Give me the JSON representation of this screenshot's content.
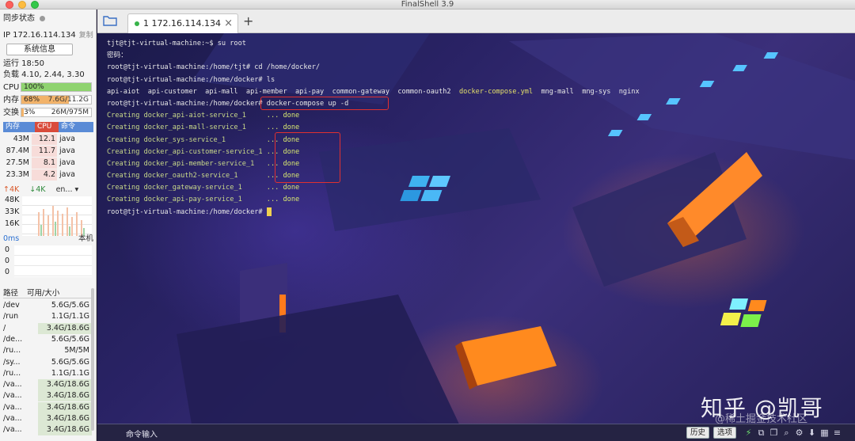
{
  "window": {
    "title": "FinalShell 3.9"
  },
  "sidebar": {
    "sync_status": "同步状态",
    "ip_label": "IP 172.16.114.134",
    "copy_label": "复制",
    "sysinfo_button": "系统信息",
    "uptime": "运行 18:50",
    "load": "负载 4.10, 2.44, 3.30",
    "cpu": {
      "label": "CPU",
      "value": "100%",
      "fraction": 1.0
    },
    "memory": {
      "label": "内存",
      "percent": "68%",
      "value": "7.6G/11.2G",
      "fraction": 0.68
    },
    "swap": {
      "label": "交换",
      "percent": "3%",
      "value": "26M/975M",
      "fraction": 0.03
    },
    "process_headers": {
      "mem": "内存",
      "cpu": "CPU",
      "cmd": "命令"
    },
    "processes": [
      {
        "mem": "43M",
        "cpu": "12.1",
        "cmd": "java"
      },
      {
        "mem": "87.4M",
        "cpu": "11.7",
        "cmd": "java"
      },
      {
        "mem": "27.5M",
        "cpu": "8.1",
        "cmd": "java"
      },
      {
        "mem": "23.3M",
        "cpu": "4.2",
        "cmd": "java"
      }
    ],
    "network": {
      "up": "4K",
      "down": "4K",
      "interface": "en...",
      "scale": [
        "48K",
        "33K",
        "16K"
      ]
    },
    "latency": {
      "label": "0ms",
      "target": "本机",
      "scale": [
        "0",
        "0",
        "0"
      ]
    },
    "disk_headers": {
      "path": "路径",
      "size": "可用/大小"
    },
    "disks": [
      {
        "path": "/dev",
        "size": "5.6G/5.6G",
        "hl": false
      },
      {
        "path": "/run",
        "size": "1.1G/1.1G",
        "hl": false
      },
      {
        "path": "/",
        "size": "3.4G/18.6G",
        "hl": true
      },
      {
        "path": "/de...",
        "size": "5.6G/5.6G",
        "hl": false
      },
      {
        "path": "/ru...",
        "size": "5M/5M",
        "hl": false
      },
      {
        "path": "/sy...",
        "size": "5.6G/5.6G",
        "hl": false
      },
      {
        "path": "/ru...",
        "size": "1.1G/1.1G",
        "hl": false
      },
      {
        "path": "/va...",
        "size": "3.4G/18.6G",
        "hl": true
      },
      {
        "path": "/va...",
        "size": "3.4G/18.6G",
        "hl": true
      },
      {
        "path": "/va...",
        "size": "3.4G/18.6G",
        "hl": true
      },
      {
        "path": "/va...",
        "size": "3.4G/18.6G",
        "hl": true
      },
      {
        "path": "/va...",
        "size": "3.4G/18.6G",
        "hl": true
      }
    ]
  },
  "tabs": [
    {
      "label": "1 172.16.114.134",
      "status": "connected"
    }
  ],
  "terminal": {
    "lines": [
      {
        "text": "tjt@tjt-virtual-machine:~$ su root",
        "cls": "c-prompt"
      },
      {
        "text": "密码：",
        "cls": "c-prompt"
      },
      {
        "text": "root@tjt-virtual-machine:/home/tjt# cd /home/docker/",
        "cls": "c-prompt"
      },
      {
        "text": "root@tjt-virtual-machine:/home/docker# ls",
        "cls": "c-prompt"
      },
      {
        "text": "api-aiot  api-customer  api-mall  api-member  api-pay  common-gateway  common-oauth2  ",
        "cls": "c-ls",
        "extra": "docker-compose.yml",
        "extra_cls": "c-yaml",
        "tail": "  mng-mall  mng-sys  nginx"
      },
      {
        "text": "root@tjt-virtual-machine:/home/docker# docker-compose up -d",
        "cls": "c-prompt"
      },
      {
        "text": "Creating docker_api-aiot-service_1     ",
        "cls": "c-create",
        "extra": "... done",
        "extra_cls": "c-done"
      },
      {
        "text": "Creating docker_api-mall-service_1     ",
        "cls": "c-create",
        "extra": "... done",
        "extra_cls": "c-done"
      },
      {
        "text": "Creating docker_sys-service_1          ",
        "cls": "c-create",
        "extra": "... done",
        "extra_cls": "c-done"
      },
      {
        "text": "Creating docker_api-customer-service_1 ",
        "cls": "c-create",
        "extra": "... done",
        "extra_cls": "c-done"
      },
      {
        "text": "Creating docker_api-member-service_1   ",
        "cls": "c-create",
        "extra": "... done",
        "extra_cls": "c-done"
      },
      {
        "text": "Creating docker_oauth2-service_1       ",
        "cls": "c-create",
        "extra": "... done",
        "extra_cls": "c-done"
      },
      {
        "text": "Creating docker_gateway-service_1      ",
        "cls": "c-create",
        "extra": "... done",
        "extra_cls": "c-done"
      },
      {
        "text": "Creating docker_api-pay-service_1      ",
        "cls": "c-create",
        "extra": "... done",
        "extra_cls": "c-done"
      },
      {
        "text": "root@tjt-virtual-machine:/home/docker# ",
        "cls": "c-prompt",
        "cursor": true
      }
    ]
  },
  "bottombar": {
    "command_input": "命令输入",
    "history": "历史",
    "options": "选项"
  },
  "watermark": {
    "main": "知乎 @凯哥",
    "sub": "@稀土掘金技术社区"
  },
  "colors": {
    "cpu_fill": "#8fd36f",
    "mem_fill": "#f2b36a",
    "accent_red": "#e03030"
  }
}
